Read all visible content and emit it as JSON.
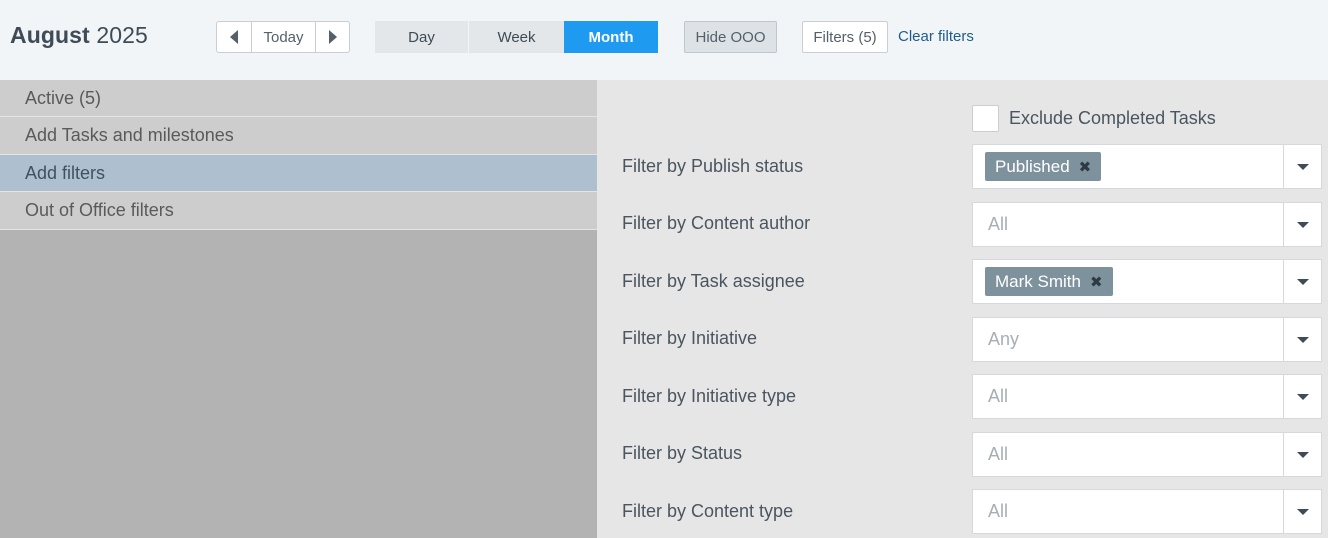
{
  "header": {
    "title_month": "August",
    "title_year": "2025",
    "today_label": "Today",
    "views": {
      "day": "Day",
      "week": "Week",
      "month": "Month",
      "active": "Month"
    },
    "hide_ooo": "Hide OOO",
    "filters_button": "Filters (5)",
    "clear_filters": "Clear filters"
  },
  "sidebar": {
    "items": [
      {
        "label": "Active (5)"
      },
      {
        "label": "Add Tasks and milestones"
      },
      {
        "label": "Add filters",
        "active": true
      },
      {
        "label": "Out of Office filters"
      }
    ]
  },
  "filters": {
    "exclude_completed": {
      "label": "Exclude Completed Tasks",
      "checked": false
    },
    "rows": [
      {
        "label": "Filter by Publish status",
        "tag": "Published"
      },
      {
        "label": "Filter by Content author",
        "placeholder": "All"
      },
      {
        "label": "Filter by Task assignee",
        "tag": "Mark Smith"
      },
      {
        "label": "Filter by Initiative",
        "placeholder": "Any"
      },
      {
        "label": "Filter by Initiative type",
        "placeholder": "All"
      },
      {
        "label": "Filter by Status",
        "placeholder": "All"
      },
      {
        "label": "Filter by Content type",
        "placeholder": "All"
      }
    ]
  },
  "colors": {
    "accent": "#1e9bf0",
    "active_menu": "#aebfd0",
    "tag_bg": "#7e929e"
  },
  "icons": {
    "prev": "caret-left-icon",
    "next": "caret-right-icon",
    "dropdown": "caret-down-icon",
    "remove_tag": "close-icon"
  }
}
